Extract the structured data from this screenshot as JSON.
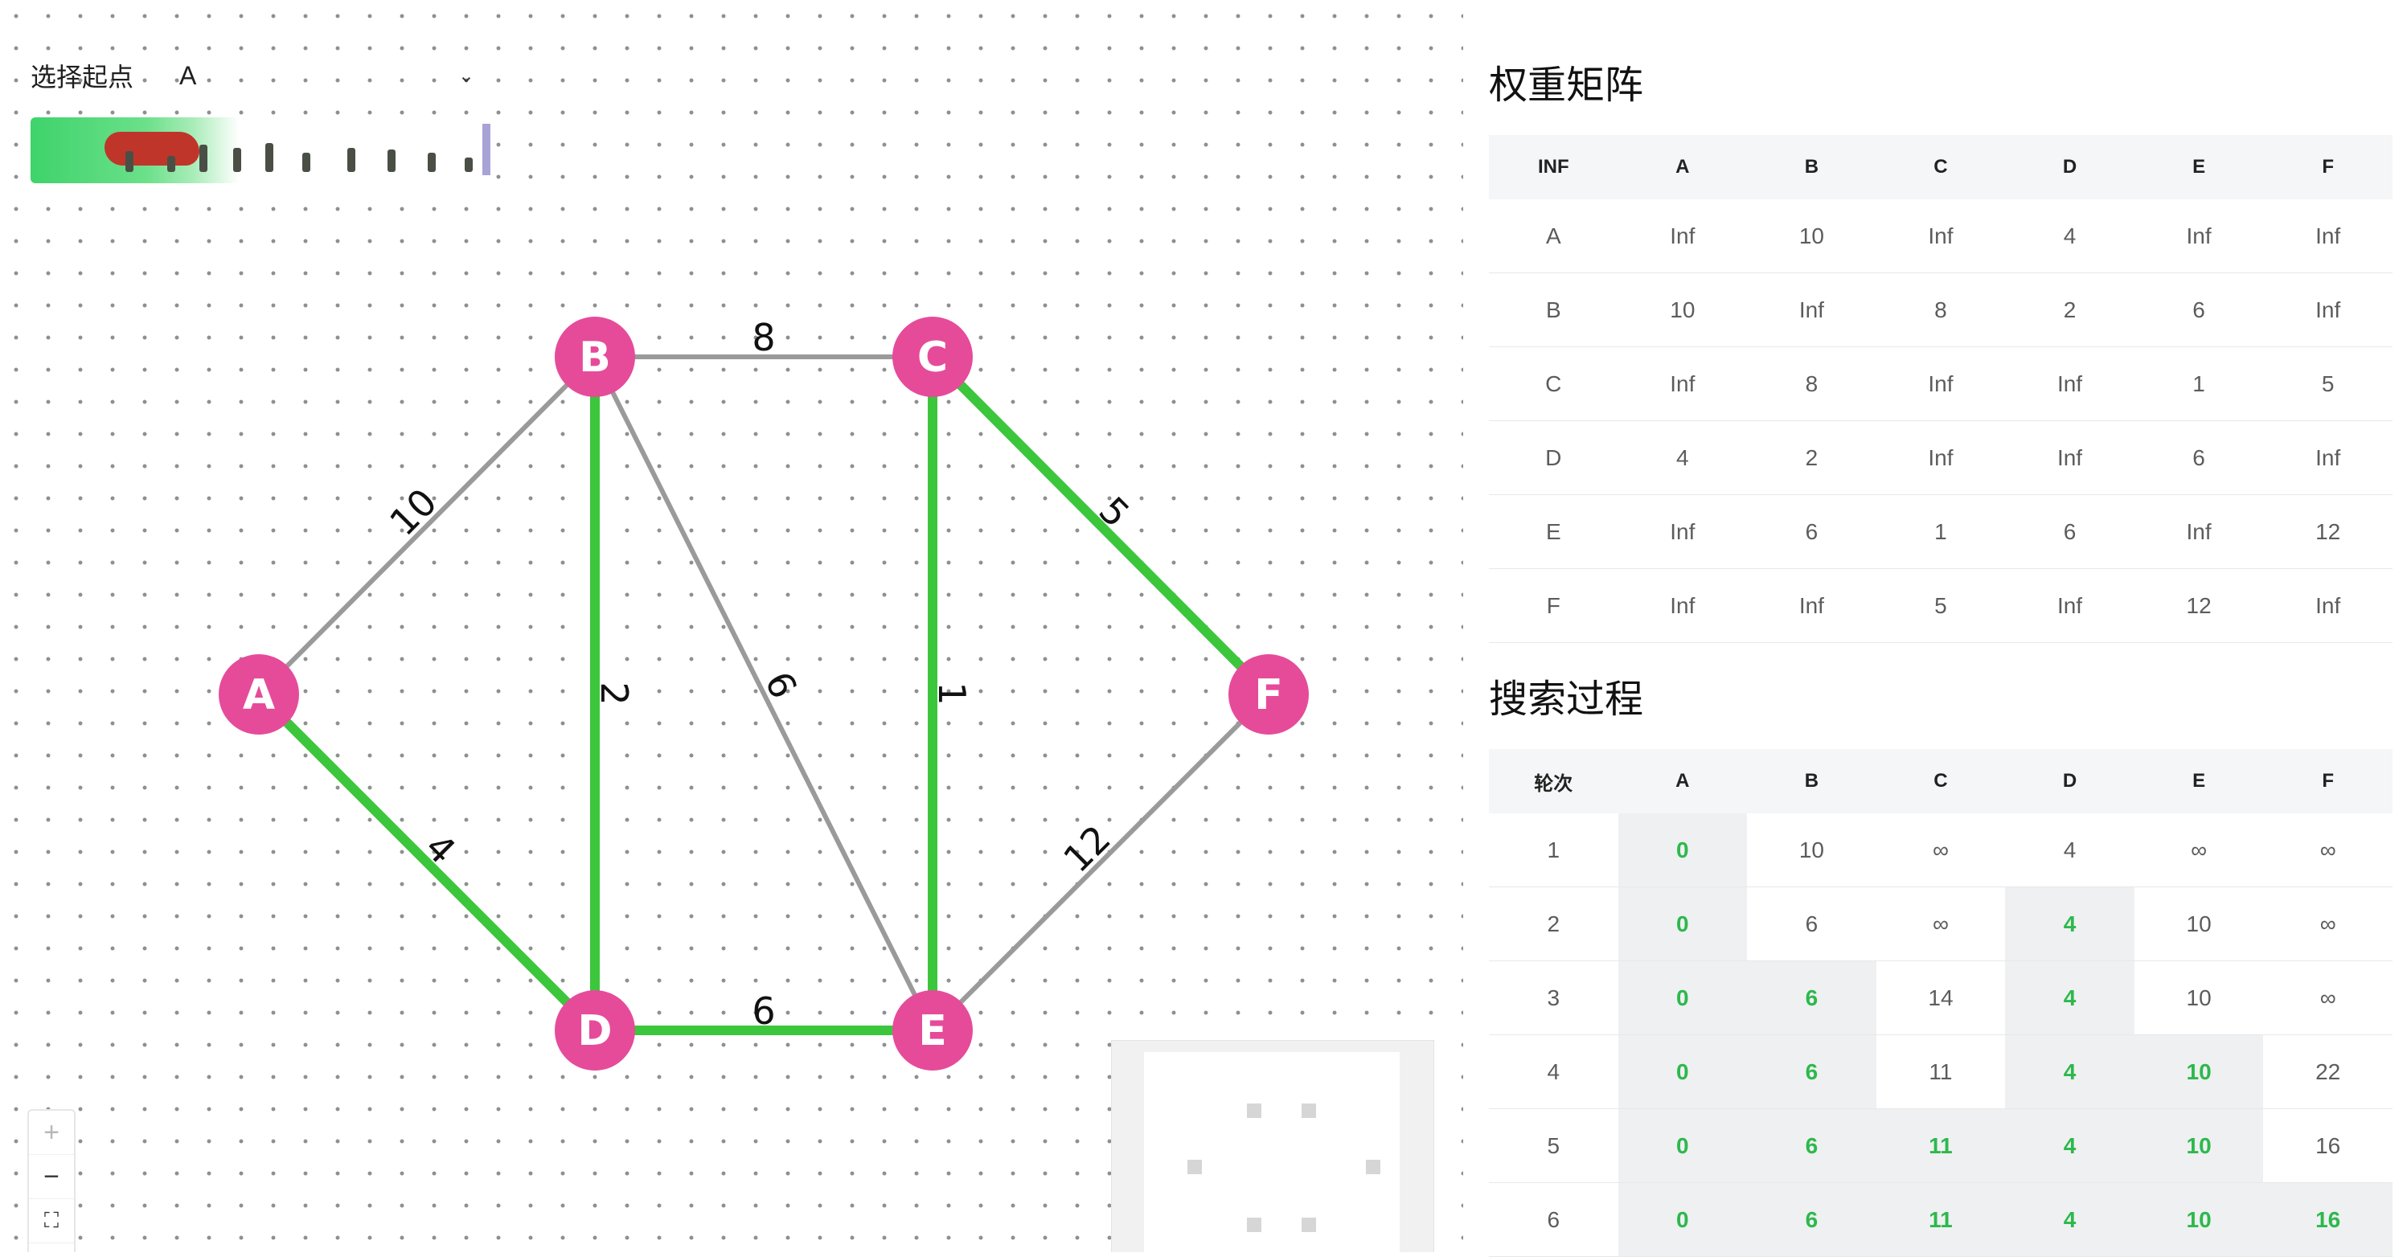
{
  "start_selector": {
    "label": "选择起点",
    "value": "A"
  },
  "graph": {
    "node_color": "#e64b9a",
    "edge_default_color": "#9a9a9a",
    "edge_highlight_color": "#3cc63c",
    "nodes": [
      {
        "id": "A"
      },
      {
        "id": "B"
      },
      {
        "id": "C"
      },
      {
        "id": "D"
      },
      {
        "id": "E"
      },
      {
        "id": "F"
      }
    ],
    "edges": [
      {
        "from": "A",
        "to": "B",
        "weight": "10",
        "highlight": false
      },
      {
        "from": "A",
        "to": "D",
        "weight": "4",
        "highlight": true
      },
      {
        "from": "B",
        "to": "C",
        "weight": "8",
        "highlight": false
      },
      {
        "from": "B",
        "to": "D",
        "weight": "2",
        "highlight": true
      },
      {
        "from": "B",
        "to": "E",
        "weight": "6",
        "highlight": false
      },
      {
        "from": "C",
        "to": "E",
        "weight": "1",
        "highlight": true
      },
      {
        "from": "C",
        "to": "F",
        "weight": "5",
        "highlight": true
      },
      {
        "from": "D",
        "to": "E",
        "weight": "6",
        "highlight": true
      },
      {
        "from": "E",
        "to": "F",
        "weight": "12",
        "highlight": false
      }
    ]
  },
  "zoom_controls": {
    "zoom_in": "+",
    "zoom_out": "−",
    "fit": "⛶",
    "more": "›"
  },
  "weight_matrix": {
    "title": "权重矩阵",
    "headers": [
      "INF",
      "A",
      "B",
      "C",
      "D",
      "E",
      "F"
    ],
    "rows": [
      [
        "A",
        "Inf",
        "10",
        "Inf",
        "4",
        "Inf",
        "Inf"
      ],
      [
        "B",
        "10",
        "Inf",
        "8",
        "2",
        "6",
        "Inf"
      ],
      [
        "C",
        "Inf",
        "8",
        "Inf",
        "Inf",
        "1",
        "5"
      ],
      [
        "D",
        "4",
        "2",
        "Inf",
        "Inf",
        "6",
        "Inf"
      ],
      [
        "E",
        "Inf",
        "6",
        "1",
        "6",
        "Inf",
        "12"
      ],
      [
        "F",
        "Inf",
        "Inf",
        "5",
        "Inf",
        "12",
        "Inf"
      ]
    ]
  },
  "search_process": {
    "title": "搜索过程",
    "headers": [
      "轮次",
      "A",
      "B",
      "C",
      "D",
      "E",
      "F"
    ],
    "rows": [
      [
        "1",
        "0",
        "10",
        "∞",
        "4",
        "∞",
        "∞"
      ],
      [
        "2",
        "0",
        "6",
        "∞",
        "4",
        "10",
        "∞"
      ],
      [
        "3",
        "0",
        "6",
        "14",
        "4",
        "10",
        "∞"
      ],
      [
        "4",
        "0",
        "6",
        "11",
        "4",
        "10",
        "22"
      ],
      [
        "5",
        "0",
        "6",
        "11",
        "4",
        "10",
        "16"
      ],
      [
        "6",
        "0",
        "6",
        "11",
        "4",
        "10",
        "16"
      ]
    ],
    "finalized": [
      [
        false,
        true,
        false,
        false,
        false,
        false,
        false
      ],
      [
        false,
        true,
        false,
        false,
        true,
        false,
        false
      ],
      [
        false,
        true,
        true,
        false,
        true,
        false,
        false
      ],
      [
        false,
        true,
        true,
        false,
        true,
        true,
        false
      ],
      [
        false,
        true,
        true,
        true,
        true,
        true,
        false
      ],
      [
        false,
        true,
        true,
        true,
        true,
        true,
        true
      ]
    ]
  }
}
